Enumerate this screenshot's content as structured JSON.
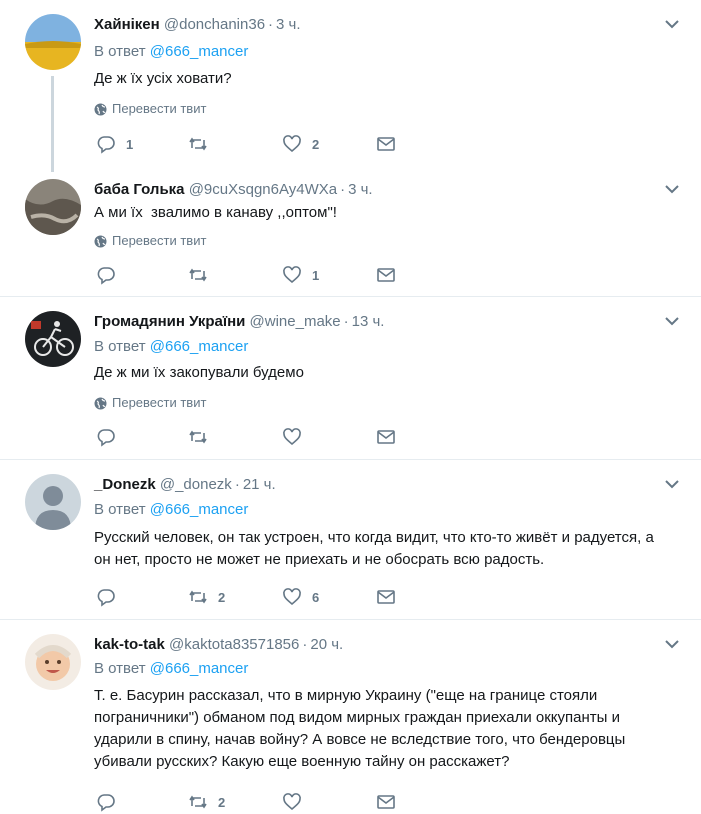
{
  "colors": {
    "accent": "#1da1f2",
    "muted": "#657786",
    "text": "#14171a",
    "border": "#e6ecf0"
  },
  "translate_label": "Перевести твит",
  "tweets": [
    {
      "fullname": "Хайнікен",
      "username": "@donchanin36",
      "time": "3 ч.",
      "reply_prefix": "В ответ",
      "reply_to": "@666_mancer",
      "text": "Де ж їх усіх ховати?",
      "replies": "1",
      "retweets": "",
      "likes": "2",
      "avatar_icon": "wheat-field-avatar"
    },
    {
      "fullname": "баба Голька",
      "username": "@9cuXsqgn6Ay4WXa",
      "time": "3 ч.",
      "reply_prefix": "",
      "reply_to": "",
      "text": "А ми їх  звалимо в канаву ,,оптом\"!",
      "replies": "",
      "retweets": "",
      "likes": "1",
      "avatar_icon": "ground-photo-avatar"
    },
    {
      "fullname": "Громадянин України",
      "username": "@wine_make",
      "time": "13 ч.",
      "reply_prefix": "В ответ",
      "reply_to": "@666_mancer",
      "text": "Де ж ми їх закопували будемо",
      "replies": "",
      "retweets": "",
      "likes": "",
      "avatar_icon": "skeleton-bike-avatar"
    },
    {
      "fullname": "_Donezk",
      "username": "@_donezk",
      "time": "21 ч.",
      "reply_prefix": "В ответ",
      "reply_to": "@666_mancer",
      "text": "Русский человек, он так устроен, что когда видит, что кто-то живёт и радуется, а он нет, просто не может не приехать и не обосрать всю радость.",
      "replies": "",
      "retweets": "2",
      "likes": "6",
      "avatar_icon": "default-user-avatar"
    },
    {
      "fullname": "kak-to-tak",
      "username": "@kaktota83571856",
      "time": "20 ч.",
      "reply_prefix": "В ответ",
      "reply_to": "@666_mancer",
      "text": "Т. е. Басурин рассказал, что в мирную Украину (\"еще на границе стояли пограничники\") обманом под видом мирных граждан приехали оккупанты и ударили в спину, начав войну? А вовсе не вследствие того, что бендеровцы убивали русских? Какую еще военную тайну он расскажет?",
      "replies": "",
      "retweets": "2",
      "likes": "",
      "avatar_icon": "baby-photo-avatar"
    }
  ]
}
